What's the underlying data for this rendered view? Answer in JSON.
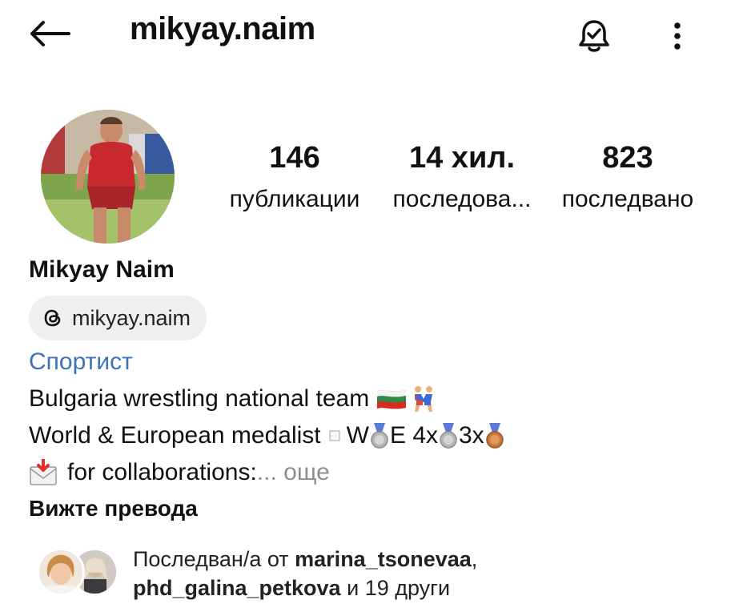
{
  "header": {
    "username": "mikyay.naim"
  },
  "stats": {
    "posts": {
      "value": "146",
      "label": "публикации"
    },
    "followers": {
      "value": "14 хил.",
      "label": "последова..."
    },
    "following": {
      "value": "823",
      "label": "последвано"
    }
  },
  "profile": {
    "display_name": "Mikyay Naim",
    "threads_handle": "mikyay.naim",
    "category": "Спортист",
    "bio": {
      "line1": "Bulgaria wrestling national team",
      "line2_a": "World & European medalist",
      "line2_b": "W",
      "line2_c": "E 4x",
      "line2_d": "3x",
      "line3": "for collaborations:",
      "more": "... още"
    },
    "translate_label": "Вижте превода"
  },
  "followed_by": {
    "prefix": "Последван/а от",
    "user1": "marina_tsonevaa",
    "separator": ",",
    "user2": "phd_galina_petkova",
    "suffix": "и 19 други"
  },
  "colors": {
    "category": "#3c73b8",
    "muted": "#8e8e8e",
    "chip_bg": "#efefef"
  }
}
